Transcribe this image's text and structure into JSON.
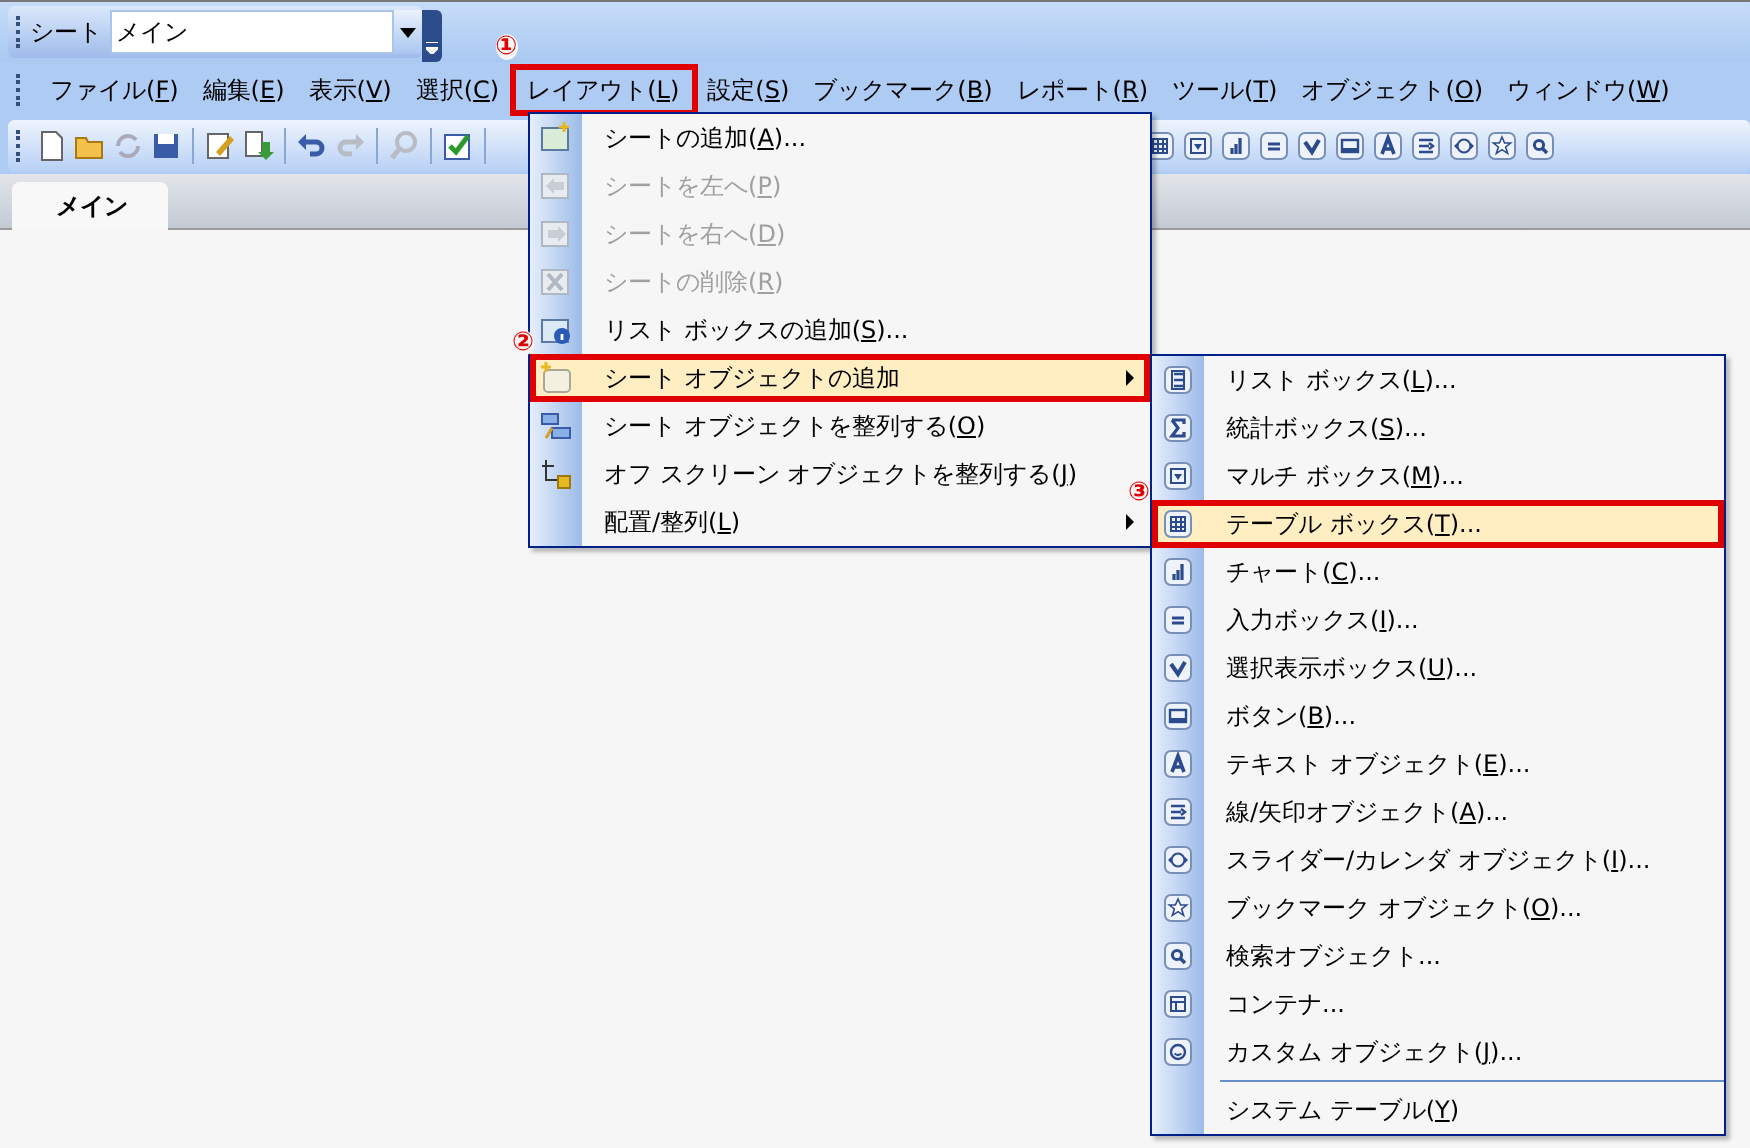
{
  "sheet_selector": {
    "label": "シート",
    "value": "メイン"
  },
  "menu_bar": [
    {
      "label": "ファイル(F)",
      "open": false
    },
    {
      "label": "編集(E)",
      "open": false
    },
    {
      "label": "表示(V)",
      "open": false
    },
    {
      "label": "選択(C)",
      "open": false
    },
    {
      "label": "レイアウト(L)",
      "open": true,
      "callout": "①"
    },
    {
      "label": "設定(S)",
      "open": false
    },
    {
      "label": "ブックマーク(B)",
      "open": false
    },
    {
      "label": "レポート(R)",
      "open": false
    },
    {
      "label": "ツール(T)",
      "open": false
    },
    {
      "label": "オブジェクト(O)",
      "open": false
    },
    {
      "label": "ウィンドウ(W)",
      "open": false
    }
  ],
  "tabs": [
    {
      "label": "メイン",
      "selected": true
    }
  ],
  "layout_menu": [
    {
      "label": "シートの追加(A)...",
      "disabled": false,
      "submenu": false,
      "highlighted": false
    },
    {
      "label": "シートを左へ(P)",
      "disabled": true,
      "submenu": false,
      "highlighted": false
    },
    {
      "label": "シートを右へ(D)",
      "disabled": true,
      "submenu": false,
      "highlighted": false
    },
    {
      "label": "シートの削除(R)",
      "disabled": true,
      "submenu": false,
      "highlighted": false
    },
    {
      "label": "リスト ボックスの追加(S)...",
      "disabled": false,
      "submenu": false,
      "highlighted": false
    },
    {
      "label": "シート オブジェクトの追加",
      "disabled": false,
      "submenu": true,
      "highlighted": true,
      "callout": "②"
    },
    {
      "label": "シート オブジェクトを整列する(O)",
      "disabled": false,
      "submenu": false,
      "highlighted": false
    },
    {
      "label": "オフ スクリーン オブジェクトを整列する(J)",
      "disabled": false,
      "submenu": false,
      "highlighted": false
    },
    {
      "label": "配置/整列(L)",
      "disabled": false,
      "submenu": true,
      "highlighted": false
    }
  ],
  "object_submenu": [
    {
      "label": "リスト ボックス(L)...",
      "highlighted": false
    },
    {
      "label": "統計ボックス(S)...",
      "highlighted": false
    },
    {
      "label": "マルチ ボックス(M)...",
      "highlighted": false
    },
    {
      "label": "テーブル ボックス(T)...",
      "highlighted": true,
      "callout": "③"
    },
    {
      "label": "チャート(C)...",
      "highlighted": false
    },
    {
      "label": "入力ボックス(I)...",
      "highlighted": false
    },
    {
      "label": "選択表示ボックス(U)...",
      "highlighted": false
    },
    {
      "label": "ボタン(B)...",
      "highlighted": false
    },
    {
      "label": "テキスト オブジェクト(E)...",
      "highlighted": false
    },
    {
      "label": "線/矢印オブジェクト(A)...",
      "highlighted": false
    },
    {
      "label": "スライダー/カレンダ オブジェクト(I)...",
      "highlighted": false
    },
    {
      "label": "ブックマーク オブジェクト(O)...",
      "highlighted": false
    },
    {
      "label": "検索オブジェクト...",
      "highlighted": false
    },
    {
      "label": "コンテナ...",
      "highlighted": false
    },
    {
      "label": "カスタム オブジェクト(J)...",
      "highlighted": false
    },
    {
      "label": "システム テーブル(Y)",
      "highlighted": false,
      "separator_before": true
    }
  ]
}
